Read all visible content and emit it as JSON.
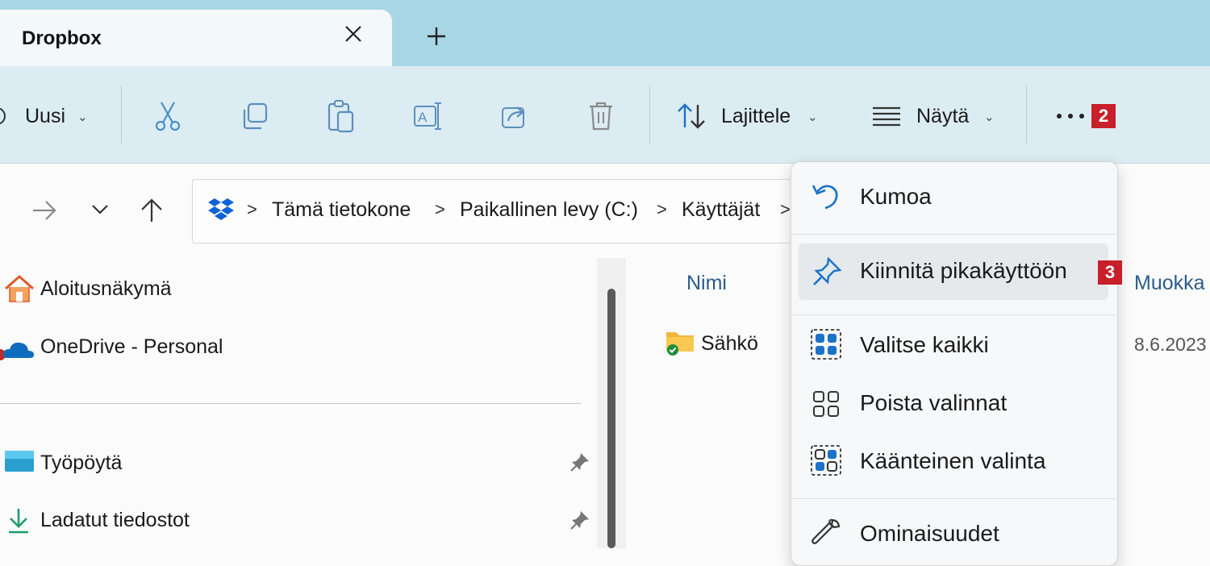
{
  "tab": {
    "title": "Dropbox",
    "close_icon": "close-icon",
    "new_icon": "plus-icon"
  },
  "toolbar": {
    "new_label": "Uusi",
    "sort_label": "Lajittele",
    "view_label": "Näytä",
    "more_badge": "2",
    "icons": [
      "cut-icon",
      "copy-icon",
      "paste-icon",
      "rename-icon",
      "share-icon",
      "delete-icon",
      "sort-icon",
      "view-icon",
      "more-icon"
    ]
  },
  "nav": {
    "icons": [
      "forward-arrow-icon",
      "recent-chevron-icon",
      "up-arrow-icon"
    ]
  },
  "breadcrumb": {
    "icon": "dropbox-icon",
    "items": [
      "Tämä tietokone",
      "Paikallinen levy (C:)",
      "Käyttäjät"
    ],
    "separator": ">"
  },
  "sidebar": {
    "items": [
      {
        "label": "Aloitusnäkymä",
        "icon": "home-icon"
      },
      {
        "label": "OneDrive - Personal",
        "icon": "onedrive-icon"
      },
      {
        "label": "Työpöytä",
        "icon": "desktop-icon",
        "pinned": true
      },
      {
        "label": "Ladatut tiedostot",
        "icon": "download-icon",
        "pinned": true
      }
    ]
  },
  "filelist": {
    "columns": [
      "Nimi",
      "Muokka"
    ],
    "rows": [
      {
        "name": "Sähkö",
        "modified": "8.6.2023",
        "icon": "folder-synced-icon"
      }
    ]
  },
  "context_menu": {
    "items": [
      {
        "label": "Kumoa",
        "icon": "undo-icon"
      },
      {
        "label": "Kiinnitä pikakäyttöön",
        "icon": "pin-icon",
        "badge": "3",
        "highlighted": true
      },
      {
        "label": "Valitse kaikki",
        "icon": "select-all-icon"
      },
      {
        "label": "Poista valinnat",
        "icon": "select-none-icon"
      },
      {
        "label": "Käänteinen valinta",
        "icon": "invert-selection-icon"
      },
      {
        "label": "Ominaisuudet",
        "icon": "properties-icon"
      }
    ]
  },
  "colors": {
    "tab_strip": "#a9d6e5",
    "toolbar": "#dcecf3",
    "badge": "#c8202a",
    "accent": "#1a73c8"
  }
}
